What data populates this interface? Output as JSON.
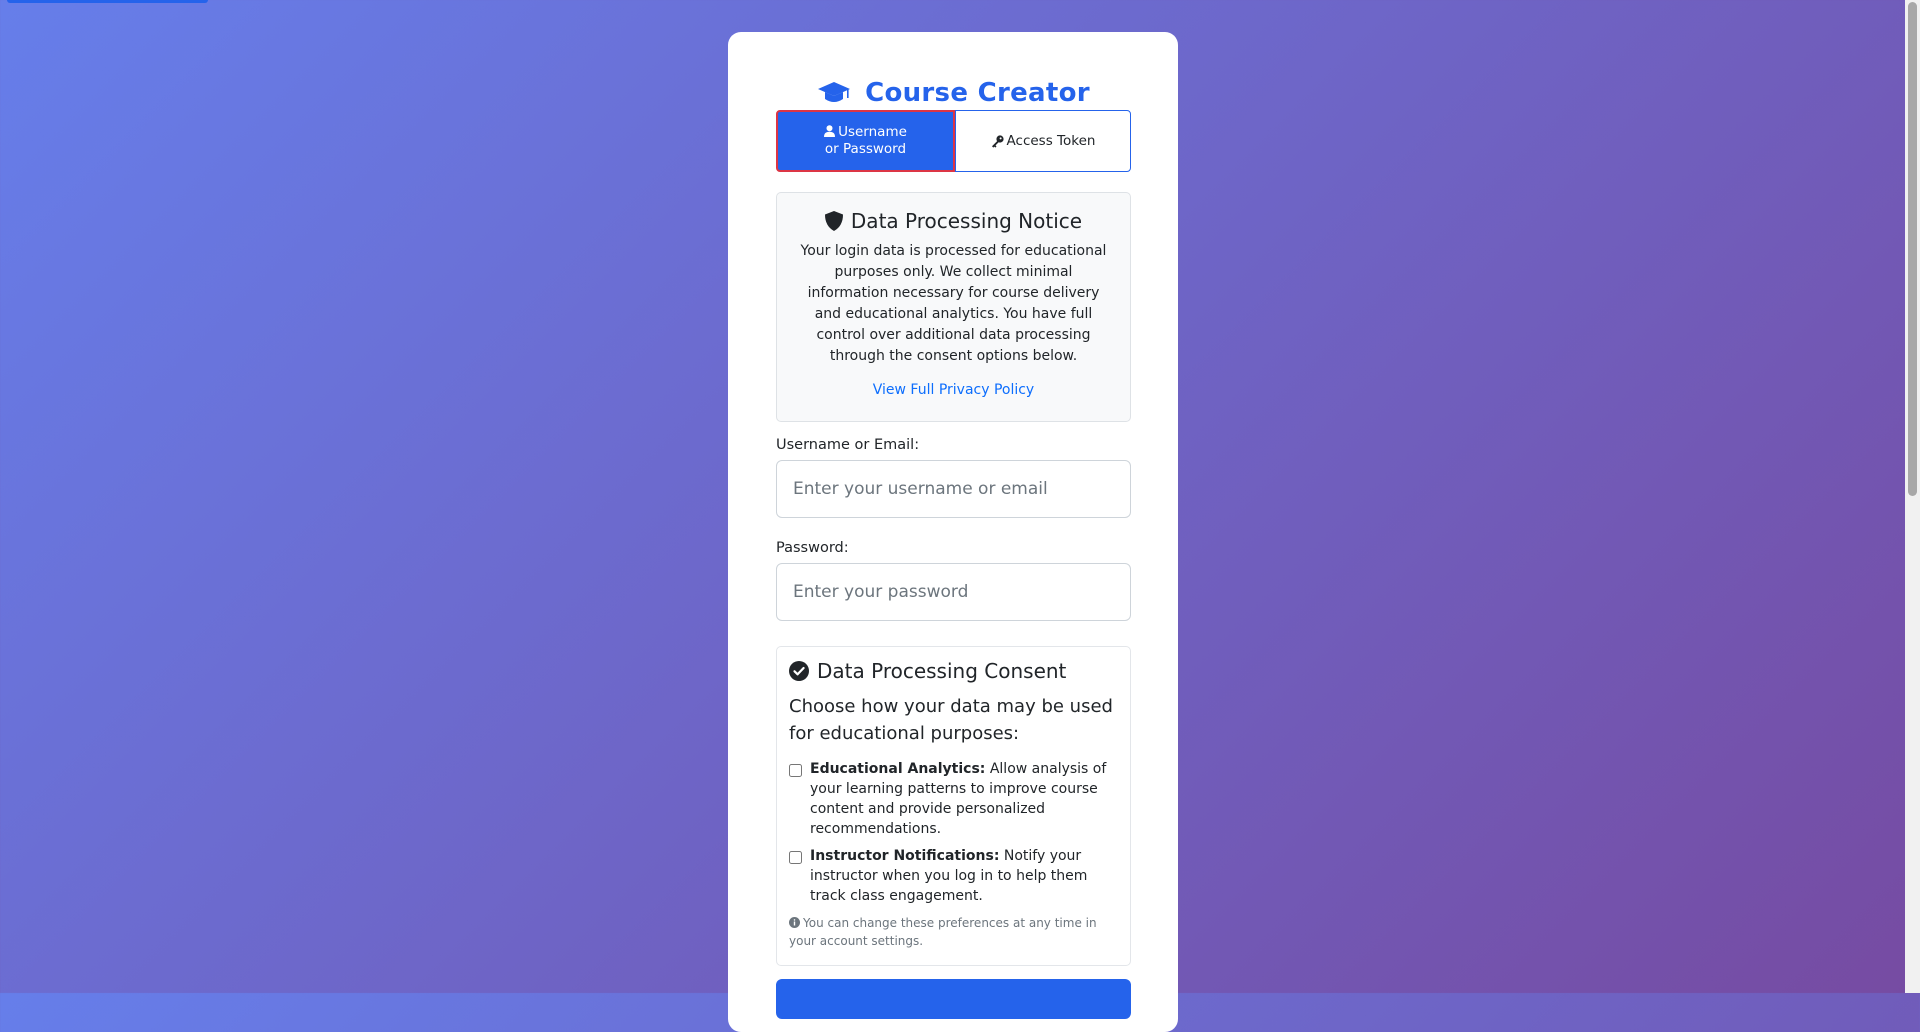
{
  "app": {
    "title": "Course Creator"
  },
  "tabs": [
    {
      "label_line1": "Username",
      "label_line2": "or Password",
      "icon": "user-icon",
      "active": true
    },
    {
      "label": "Access Token",
      "icon": "key-icon",
      "active": false
    }
  ],
  "notice": {
    "title": "Data Processing Notice",
    "icon": "shield-icon",
    "body": "Your login data is processed for educational purposes only. We collect minimal information necessary for course delivery and educational analytics. You have full control over additional data processing through the consent options below.",
    "link": "View Full Privacy Policy"
  },
  "form": {
    "username_label": "Username or Email:",
    "username_placeholder": "Enter your username or email",
    "username_value": "",
    "password_label": "Password:",
    "password_placeholder": "Enter your password",
    "password_value": ""
  },
  "consent": {
    "title": "Data Processing Consent",
    "icon": "check-circle-icon",
    "intro": "Choose how your data may be used for educational purposes:",
    "options": [
      {
        "title": "Educational Analytics:",
        "text": " Allow analysis of your learning patterns to improve course content and provide personalized recommendations.",
        "checked": false
      },
      {
        "title": "Instructor Notifications:",
        "text": " Notify your instructor when you log in to help them track class engagement.",
        "checked": false
      }
    ],
    "hint": "You can change these preferences at any time in your account settings.",
    "hint_icon": "info-circle-icon"
  },
  "colors": {
    "primary": "#2563eb",
    "active_tab_border": "#dc3545",
    "link": "#0d6efd",
    "bg_start": "#667eea",
    "bg_end": "#764ba2"
  }
}
